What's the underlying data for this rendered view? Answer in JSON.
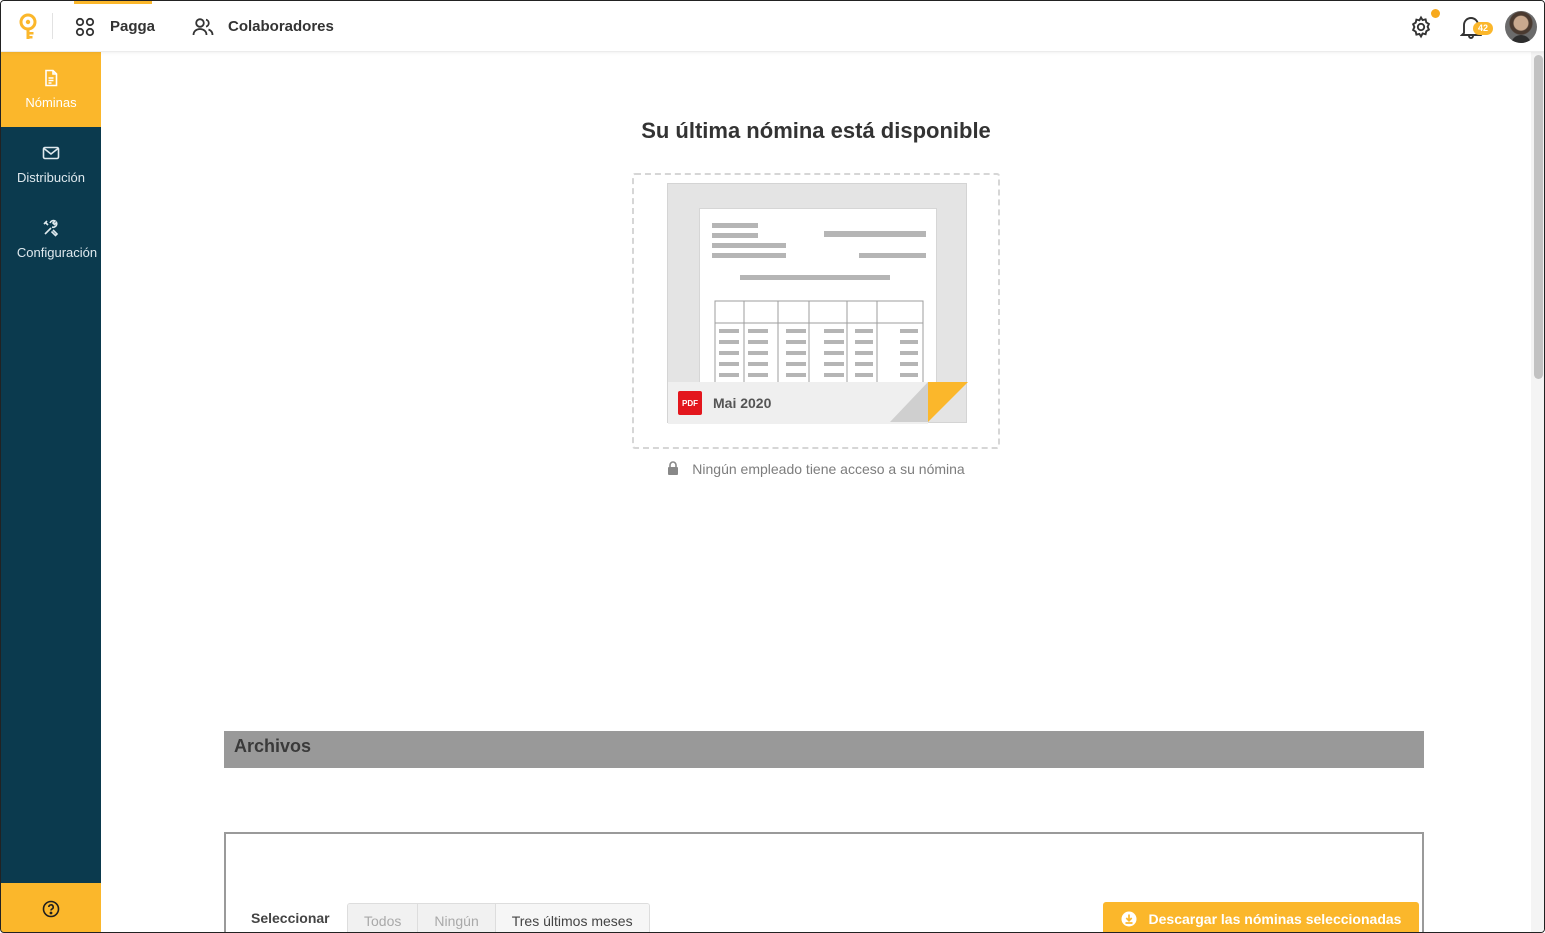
{
  "topnav": {
    "items": [
      {
        "label": "Pagga",
        "icon": "grid-icon"
      },
      {
        "label": "Colaboradores",
        "icon": "users-icon"
      }
    ],
    "notifications_count": "42"
  },
  "sidebar": {
    "items": [
      {
        "label": "Nóminas",
        "icon": "document-icon"
      },
      {
        "label": "Distribución",
        "icon": "envelope-icon"
      },
      {
        "label": "Configuración",
        "icon": "tools-icon"
      }
    ]
  },
  "main": {
    "headline": "Su última nómina está disponible",
    "latest_payslip": {
      "badge": "PDF",
      "month": "Mai 2020"
    },
    "access_note": "Ningún empleado tiene acceso a su nómina"
  },
  "files": {
    "header": "Archivos",
    "select_label": "Seleccionar",
    "filters": [
      "Todos",
      "Ningún",
      "Tres últimos meses"
    ],
    "download_label": "Descargar las nóminas seleccionadas"
  },
  "colors": {
    "accent": "#fbb72b",
    "sidebar": "#0b3a4e",
    "pdf_red": "#e3161d"
  }
}
